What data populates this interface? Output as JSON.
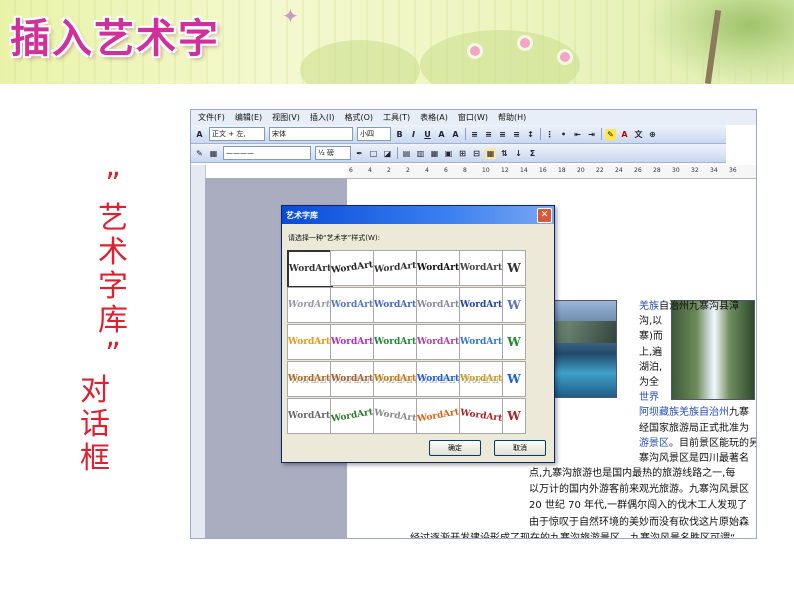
{
  "slide": {
    "title": "插入艺术字",
    "side_label_1": [
      "”",
      "艺",
      "术",
      "字",
      "库",
      "”"
    ],
    "side_label_2": [
      "对",
      "话",
      "框"
    ]
  },
  "word": {
    "menu": [
      "文件(F)",
      "编辑(E)",
      "视图(V)",
      "插入(I)",
      "格式(O)",
      "工具(T)",
      "表格(A)",
      "窗口(W)",
      "帮助(H)"
    ],
    "style_box": "正文 + 左,",
    "font_box": "宋体",
    "size_box": "小四",
    "line_box": "————",
    "weight_box": "½ 磅",
    "ruler_numbers": [
      "6",
      "4",
      "2",
      "2",
      "4",
      "6",
      "8",
      "10",
      "12",
      "14",
      "16",
      "18",
      "20",
      "22",
      "24",
      "26",
      "28",
      "30",
      "32",
      "34",
      "36"
    ],
    "doc_lines": [
      {
        "pre": "",
        "link": "羌族",
        "post": "自治州九寨沟县漳"
      },
      {
        "pre": "沟,以",
        "link": "",
        "post": ""
      },
      {
        "pre": "寨)而",
        "link": "",
        "post": ""
      },
      {
        "pre": "上,遍",
        "link": "",
        "post": ""
      },
      {
        "pre": "湖泊,",
        "link": "",
        "post": ""
      },
      {
        "pre": "为全",
        "link": "",
        "post": ""
      },
      {
        "pre": "",
        "link": "世界",
        "post": ""
      },
      {
        "pre": "",
        "link": "阿坝藏族羌族自治州",
        "post": "九寨"
      },
      {
        "pre": "经国家旅游局正式批准为",
        "link": "",
        "post": ""
      },
      {
        "pre": "",
        "link": "游景区",
        "post": "。目前景区能玩的另"
      },
      {
        "pre": "寨沟风景区是四川最著名",
        "link": "",
        "post": ""
      }
    ],
    "body_lines": [
      "点,九寨沟旅游也是国内最热的旅游线路之一,每",
      "以万计的国内外游客前来观光旅游。九寨沟风景区",
      "20 世纪 70 年代,一群偶尔闯入的伐木工人发现了",
      "由于惊叹于自然环境的美妙而没有砍伐这片原始森",
      "经过逐渐开发建设形成了现在的九寨沟旅游景区。九寨沟风景名胜区可谓“"
    ]
  },
  "dialog": {
    "title": "艺术字库",
    "prompt": "请选择一种“艺术字”样式(W):",
    "sample_text": "WordArt",
    "vertical_sample": "W",
    "ok_label": "确定",
    "cancel_label": "取消",
    "styles": [
      [
        "#333333",
        "#222222",
        "#333333",
        "#111111",
        "#444444"
      ],
      [
        "#9999aa",
        "#5577bb",
        "#4466cc",
        "#888899",
        "#2244aa"
      ],
      [
        "#e89a10",
        "#b030c0",
        "#228833",
        "#aa44aa",
        "#3377cc"
      ],
      [
        "#b06a20",
        "#a06030",
        "#c07a10",
        "#2060d0",
        "#c0a020"
      ],
      [
        "#666666",
        "#2a7a2a",
        "#888888",
        "#e06010",
        "#aa2222"
      ]
    ]
  },
  "colors": {
    "title": "#d0309a",
    "side_label": "#e02030",
    "link": "#2850b8"
  }
}
